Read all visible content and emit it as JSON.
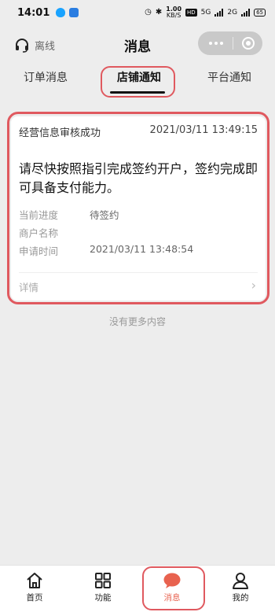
{
  "status_bar": {
    "time": "14:01",
    "net_speed_value": "1.00",
    "net_speed_unit": "KB/S",
    "hd": "HD",
    "network_1": "5G",
    "network_2": "2G",
    "battery": "65"
  },
  "header": {
    "offline_label": "离线",
    "title": "消息"
  },
  "tabs": [
    {
      "label": "订单消息"
    },
    {
      "label": "店铺通知"
    },
    {
      "label": "平台通知"
    }
  ],
  "card": {
    "title": "经营信息审核成功",
    "datetime": "2021/03/11 13:49:15",
    "body": "请尽快按照指引完成签约开户，签约完成即可具备支付能力。",
    "fields": [
      {
        "key": "当前进度",
        "value": "待签约"
      },
      {
        "key": "商户名称",
        "value": ""
      },
      {
        "key": "申请时间",
        "value": "2021/03/11 13:48:54"
      }
    ],
    "details_label": "详情"
  },
  "no_more_text": "没有更多内容",
  "bottom_nav": [
    {
      "label": "首页",
      "icon": "home-icon"
    },
    {
      "label": "功能",
      "icon": "grid-icon"
    },
    {
      "label": "消息",
      "icon": "chat-bubble-icon"
    },
    {
      "label": "我的",
      "icon": "person-icon"
    }
  ],
  "colors": {
    "accent": "#e8624f",
    "highlight": "#e0595f"
  }
}
